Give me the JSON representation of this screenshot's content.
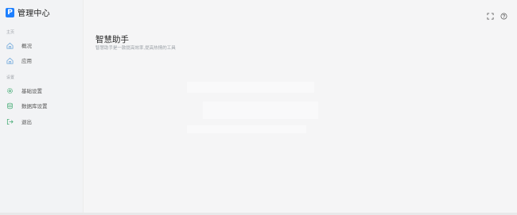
{
  "brand": {
    "logo_letter": "P",
    "title": "管理中心"
  },
  "sidebar": {
    "sections": [
      {
        "title": "主页"
      },
      {
        "title": "设置"
      }
    ],
    "items": [
      {
        "label": "概况",
        "icon": "home-icon"
      },
      {
        "label": "应用",
        "icon": "home-icon"
      },
      {
        "label": "基础设置",
        "icon": "gear-icon"
      },
      {
        "label": "数据库设置",
        "icon": "database-icon"
      },
      {
        "label": "退出",
        "icon": "logout-icon"
      }
    ]
  },
  "header": {
    "actions": [
      {
        "icon": "fullscreen-icon"
      },
      {
        "icon": "help-icon"
      }
    ]
  },
  "main": {
    "title": "智慧助手",
    "subtitle": "智慧助手是一款提高效率,提高热情的工具"
  },
  "colors": {
    "accent": "#1e80ff",
    "icon_blue": "#5b9bd5",
    "icon_green": "#3cb371"
  }
}
